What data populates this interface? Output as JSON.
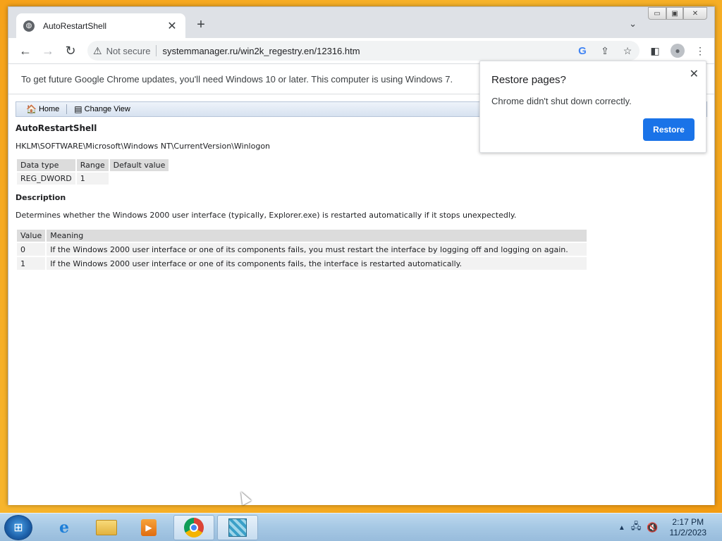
{
  "tab": {
    "title": "AutoRestartShell",
    "close": "✕",
    "new": "+"
  },
  "window_controls": {
    "min": "▭",
    "max": "▣",
    "close": "✕"
  },
  "toolbar": {
    "back": "←",
    "forward": "→",
    "reload": "↻",
    "security_icon": "⚠",
    "security_text": "Not secure",
    "url": "systemmanager.ru/win2k_regestry.en/12316.htm",
    "google_icon": "G",
    "share_icon": "⇪",
    "star_icon": "☆",
    "sidepanel_icon": "◧",
    "menu_icon": "⋮",
    "tabsearch_icon": "⌄",
    "profile_icon": "●"
  },
  "infobar": {
    "text": "To get future Google Chrome updates, you'll need Windows 10 or later. This computer is using Windows 7."
  },
  "site": {
    "nav": {
      "home": "Home",
      "change_view": "Change View"
    },
    "key_name": "AutoRestartShell",
    "path": "HKLM\\SOFTWARE\\Microsoft\\Windows NT\\CurrentVersion\\Winlogon",
    "props": {
      "headers": [
        "Data type",
        "Range",
        "Default value"
      ],
      "row": [
        "REG_DWORD",
        "1",
        ""
      ]
    },
    "description_title": "Description",
    "description": "Determines whether the Windows 2000 user interface (typically, Explorer.exe) is restarted automatically if it stops unexpectedly.",
    "values": {
      "headers": [
        "Value",
        "Meaning"
      ],
      "rows": [
        [
          "0",
          "If the Windows 2000 user interface or one of its components fails, you must restart the interface by logging off and logging on again."
        ],
        [
          "1",
          "If the Windows 2000 user interface or one of its components fails, the interface is restarted automatically."
        ]
      ]
    }
  },
  "popup": {
    "title": "Restore pages?",
    "message": "Chrome didn't shut down correctly.",
    "button": "Restore",
    "close": "✕"
  },
  "taskbar": {
    "ie_glyph": "e",
    "media_glyph": "▶",
    "tray_arrow": "▲",
    "net_icon": "🖧",
    "volume_icon": "🔇",
    "time": "2:17 PM",
    "date": "11/2/2023"
  }
}
